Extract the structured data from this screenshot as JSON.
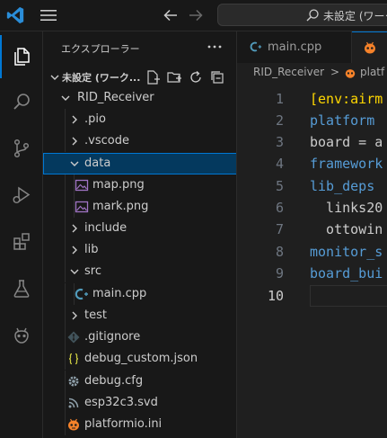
{
  "titlebar": {
    "search_text": "未設定 (ワーク"
  },
  "explorer": {
    "title": "エクスプローラー",
    "workspace_label": "未設定 (ワーク...",
    "tree": [
      {
        "label": "RID_Receiver",
        "kind": "folder",
        "state": "expanded",
        "icon": "chevron-down-icon"
      },
      {
        "label": ".pio",
        "kind": "folder",
        "state": "collapsed",
        "icon": "chevron-right-icon"
      },
      {
        "label": ".vscode",
        "kind": "folder",
        "state": "collapsed",
        "icon": "chevron-right-icon"
      },
      {
        "label": "data",
        "kind": "folder",
        "state": "expanded",
        "selected": true,
        "icon": "chevron-down-icon"
      },
      {
        "label": "map.png",
        "kind": "file",
        "icon": "image-file-icon"
      },
      {
        "label": "mark.png",
        "kind": "file",
        "icon": "image-file-icon"
      },
      {
        "label": "include",
        "kind": "folder",
        "state": "collapsed",
        "icon": "chevron-right-icon"
      },
      {
        "label": "lib",
        "kind": "folder",
        "state": "collapsed",
        "icon": "chevron-right-icon"
      },
      {
        "label": "src",
        "kind": "folder",
        "state": "expanded",
        "icon": "chevron-down-icon"
      },
      {
        "label": "main.cpp",
        "kind": "file",
        "icon": "cpp-file-icon"
      },
      {
        "label": "test",
        "kind": "folder",
        "state": "collapsed",
        "icon": "chevron-right-icon"
      },
      {
        "label": ".gitignore",
        "kind": "file",
        "icon": "gitignore-file-icon"
      },
      {
        "label": "debug_custom.json",
        "kind": "file",
        "icon": "json-file-icon"
      },
      {
        "label": "debug.cfg",
        "kind": "file",
        "icon": "gear-file-icon"
      },
      {
        "label": "esp32c3.svd",
        "kind": "file",
        "icon": "rss-file-icon"
      },
      {
        "label": "platformio.ini",
        "kind": "file",
        "icon": "platformio-file-icon"
      }
    ]
  },
  "editor": {
    "tabs": [
      {
        "label": "main.cpp",
        "icon": "cpp-file-icon",
        "active": false
      },
      {
        "label": "",
        "icon": "platformio-file-icon",
        "active": true
      }
    ],
    "breadcrumb": {
      "folder": "RID_Receiver",
      "separator": ">",
      "file": "platf"
    },
    "lines": [
      {
        "num": "1",
        "text": "[env:airm",
        "color": "#ffd700"
      },
      {
        "num": "2",
        "text": "platform ",
        "color": "#569cd6"
      },
      {
        "num": "3",
        "text": "board = a",
        "color": "#cccccc"
      },
      {
        "num": "4",
        "text": "framework",
        "color": "#569cd6"
      },
      {
        "num": "5",
        "text": "lib_deps ",
        "color": "#569cd6"
      },
      {
        "num": "6",
        "text": "  links20",
        "color": "#cccccc"
      },
      {
        "num": "7",
        "text": "  ottowin",
        "color": "#cccccc"
      },
      {
        "num": "8",
        "text": "monitor_s",
        "color": "#569cd6"
      },
      {
        "num": "9",
        "text": "board_bui",
        "color": "#569cd6"
      },
      {
        "num": "10",
        "text": "",
        "color": "#cccccc"
      }
    ]
  },
  "colors": {
    "accent": "#0078d4",
    "selection_bg": "#04395e",
    "cpp_icon": "#519aba",
    "platformio_icon": "#f5822a",
    "json_icon": "#cbcb41",
    "image_icon": "#a074c4"
  }
}
